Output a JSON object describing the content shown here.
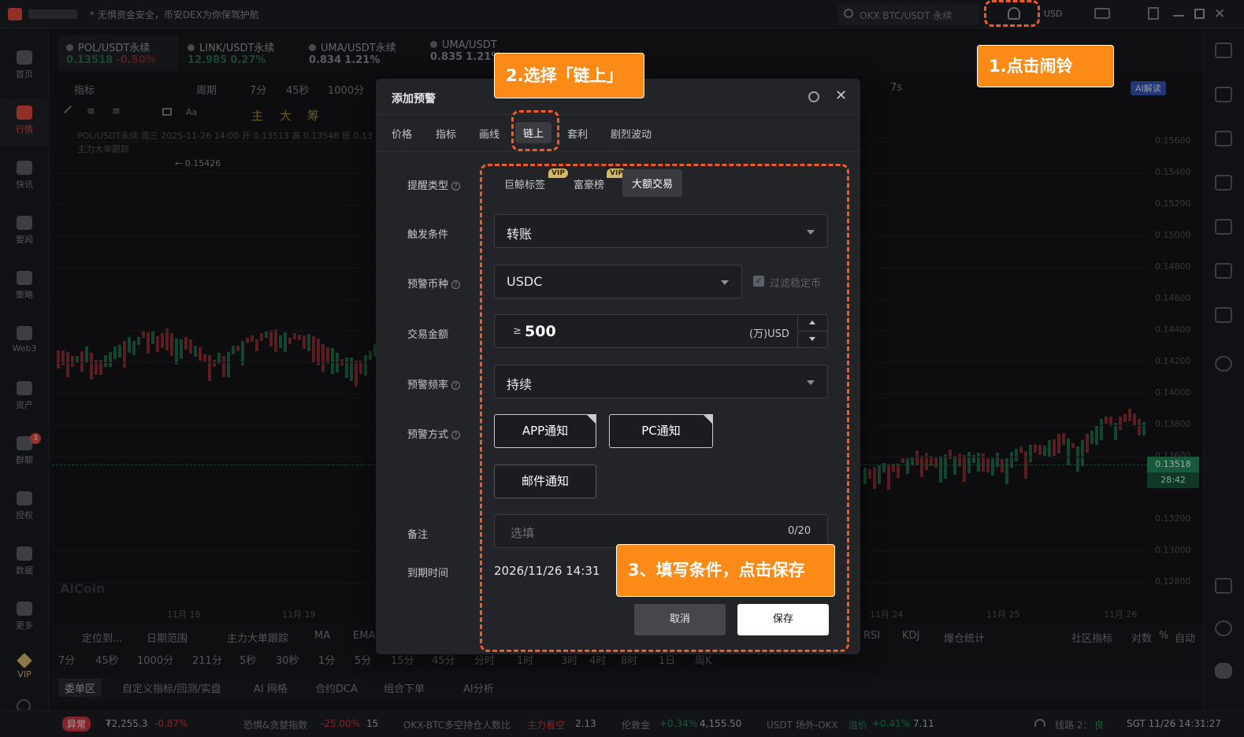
{
  "topbar": {
    "notice": "* 无惧资金安全，币安DEX为你保驾护航",
    "search_placeholder": "OKX BTC/USDT 永续",
    "currency": "USD"
  },
  "nav": [
    {
      "label": "首页"
    },
    {
      "label": "行情"
    },
    {
      "label": "快讯"
    },
    {
      "label": "要闻"
    },
    {
      "label": "策略"
    },
    {
      "label": "Web3"
    },
    {
      "label": "资产"
    },
    {
      "label": "群聊",
      "badge": "3"
    },
    {
      "label": "授权"
    },
    {
      "label": "数据"
    },
    {
      "label": "更多"
    },
    {
      "label": "VIP"
    }
  ],
  "tickers": [
    {
      "name": "POL/USDT永续",
      "price": "0.13518",
      "change": "-0.50%"
    },
    {
      "name": "LINK/USDT永续",
      "price": "12.985",
      "change": "0.27%"
    },
    {
      "name": "UMA/USDT永续",
      "price": "0.834",
      "change": "1.21%"
    },
    {
      "name": "UMA/USDT",
      "price": "0.835",
      "change": "1.21%"
    }
  ],
  "toolbar": {
    "indicator": "指标",
    "period": "周期",
    "t7": "7分",
    "t45": "45秒",
    "t1000": "1000分",
    "seven_s": "7s",
    "ai": "AI解读",
    "draw_zhu": "主",
    "draw_da": "大",
    "draw_chou": "筹"
  },
  "chart": {
    "info": "POL/USDT永续 周三 2025-11-26 14:00 开 0.13513 高 0.13548 低 0.13",
    "info2": "主力大单跟踪",
    "high_mark": "← 0.15426",
    "price_labels": [
      "0.15600",
      "0.15400",
      "0.15200",
      "0.15000",
      "0.14800",
      "0.14600",
      "0.14400",
      "0.14200",
      "0.14000",
      "0.13800",
      "0.13600",
      "0.13200",
      "0.13000",
      "0.12800"
    ],
    "current_price": "0.13518",
    "countdown": "28:42",
    "dates": [
      "11月 18",
      "11月 19",
      "11月 24",
      "11月 25",
      "11月 26"
    ],
    "watermark": "AiCoin"
  },
  "bottom": {
    "row1": [
      "定位到...",
      "日期范围",
      "主力大单跟踪",
      "MA",
      "EMA",
      "RSI",
      "KDJ",
      "爆仓统计",
      "社区指标",
      "对数",
      "%",
      "自动"
    ],
    "row2": [
      "7分",
      "45秒",
      "1000分",
      "211分",
      "5秒",
      "30秒",
      "1分",
      "5分",
      "15分",
      "45分",
      "分时",
      "1时",
      "3时",
      "4时",
      "8时",
      "1日",
      "周K"
    ]
  },
  "order_tabs": [
    "委单区",
    "自定义指标/回测/实盘",
    "AI 网格",
    "合约DCA",
    "组合下单",
    "AI分析"
  ],
  "status": {
    "tag": "异常",
    "index": "₮2,255.3",
    "index_change": "-0.87%",
    "fear": "恐惧&贪婪指数",
    "fear_change": "-25.00%",
    "fear_val": "15",
    "okx": "OKX-BTC多空持仓人数比",
    "okx_tag": "主力看空",
    "okx_val": "2.13",
    "gold": "伦敦金",
    "gold_change": "+0.34%",
    "gold_val": "4,155.50",
    "usdt": "USDT 场外-OKX",
    "usdt_tag": "溢价",
    "usdt_change": "+0.41%",
    "usdt_val": "7.11",
    "line": "线路 2：",
    "line_quality": "良",
    "time": "SGT  11/26 14:31:27"
  },
  "modal": {
    "title": "添加预警",
    "tabs": [
      "价格",
      "指标",
      "画线",
      "链上",
      "套利",
      "剧烈波动"
    ],
    "labels": {
      "type": "提醒类型",
      "trigger": "触发条件",
      "coin": "预警币种",
      "amount": "交易金额",
      "freq": "预警频率",
      "method": "预警方式",
      "note": "备注",
      "expire": "到期时间"
    },
    "subtabs": [
      "巨鲸标签",
      "富豪榜",
      "大额交易"
    ],
    "vip": "VIP",
    "trigger_value": "转账",
    "coin_value": "USDC",
    "filter_stable": "过滤稳定币",
    "amount_prefix": "≥",
    "amount_value": "500",
    "amount_unit": "(万)USD",
    "freq_value": "持续",
    "notify": [
      "APP通知",
      "PC通知",
      "邮件通知"
    ],
    "note_placeholder": "选填",
    "note_count": "0/20",
    "expire_value": "2026/11/26 14:31",
    "cancel": "取消",
    "save": "保存"
  },
  "callouts": {
    "step1": "1.点击闹铃",
    "step2": "2.选择「链上」",
    "step3": "3、填写条件，点击保存"
  },
  "colors": {
    "accent": "#fb8a16",
    "dash": "#ef5a2a",
    "up": "#1f8a5b",
    "down": "#c8383f"
  }
}
